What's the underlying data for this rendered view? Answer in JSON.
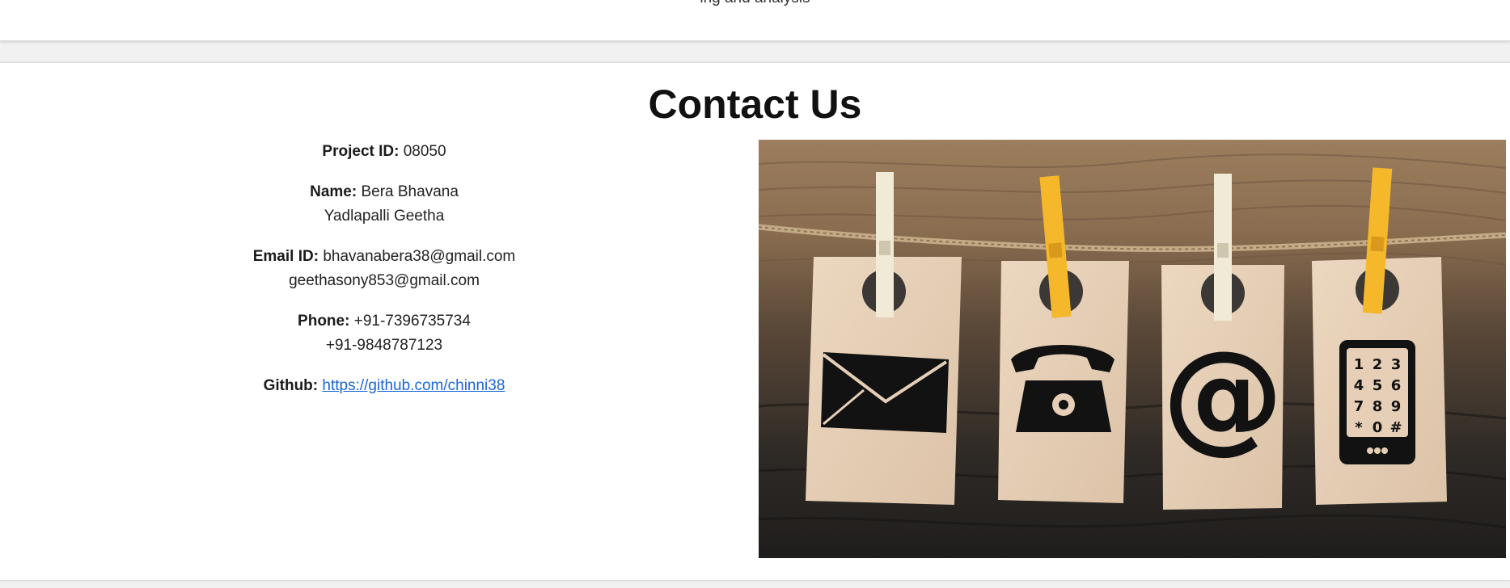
{
  "top_section": {
    "cut_text": "ing and analysis"
  },
  "contact": {
    "title": "Contact Us",
    "project": {
      "label": "Project ID:",
      "value": "08050"
    },
    "name": {
      "label": "Name:",
      "line1": "Bera Bhavana",
      "line2": "Yadlapalli Geetha"
    },
    "email": {
      "label": "Email ID:",
      "line1": "bhavanabera38@gmail.com",
      "line2": "geethasony853@gmail.com"
    },
    "phone": {
      "label": "Phone:",
      "line1": "+91-7396735734",
      "line2": "+91-9848787123"
    },
    "github": {
      "label": "Github:",
      "url": "https://github.com/chinni38"
    }
  },
  "image": {
    "keypad": [
      "1",
      "2",
      "3",
      "4",
      "5",
      "6",
      "7",
      "8",
      "9",
      "*",
      "0",
      "#"
    ]
  },
  "colors": {
    "link": "#1a66d6",
    "clip_yellow": "#f5b82a",
    "clip_cream": "#f1ead6",
    "tag_kraft": "#e6cfb6"
  }
}
